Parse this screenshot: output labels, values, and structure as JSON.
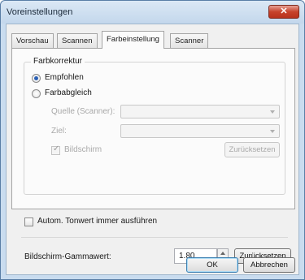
{
  "window": {
    "title": "Voreinstellungen",
    "close_label": "✕"
  },
  "tabs": [
    {
      "label": "Vorschau"
    },
    {
      "label": "Scannen"
    },
    {
      "label": "Farbeinstellung"
    },
    {
      "label": "Scanner"
    }
  ],
  "color_correction": {
    "group_title": "Farbkorrektur",
    "recommended_label": "Empfohlen",
    "color_matching_label": "Farbabgleich",
    "source_label": "Quelle (Scanner):",
    "target_label": "Ziel:",
    "screen_label": "Bildschirm",
    "reset_label": "Zurücksetzen"
  },
  "auto_tone_label": "Autom. Tonwert immer ausführen",
  "gamma": {
    "label": "Bildschirm-Gammawert:",
    "value": "1.80",
    "reset_label": "Zurücksetzen"
  },
  "footer": {
    "ok_label": "OK",
    "cancel_label": "Abbrechen"
  }
}
